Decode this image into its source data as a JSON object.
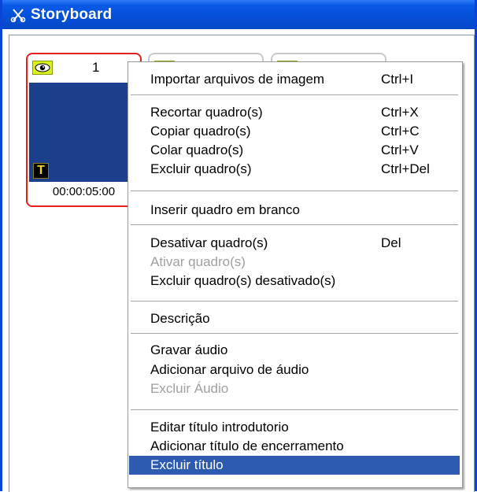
{
  "window": {
    "title": "Storyboard",
    "title_icon": "scissors-icon"
  },
  "frames": [
    {
      "number": "1",
      "duration": "00:00:05:00",
      "selected": true,
      "has_title": true,
      "title_badge": "T"
    },
    {
      "selected": false
    },
    {
      "selected": false
    }
  ],
  "context_menu": {
    "items": [
      {
        "label": "Importar arquivos de imagem",
        "shortcut": "Ctrl+I",
        "enabled": true
      },
      {
        "label": "Recortar quadro(s)",
        "shortcut": "Ctrl+X",
        "enabled": true
      },
      {
        "label": "Copiar quadro(s)",
        "shortcut": "Ctrl+C",
        "enabled": true
      },
      {
        "label": "Colar quadro(s)",
        "shortcut": "Ctrl+V",
        "enabled": true
      },
      {
        "label": "Excluir quadro(s)",
        "shortcut": "Ctrl+Del",
        "enabled": true
      },
      {
        "label": "Inserir quadro em branco",
        "shortcut": "",
        "enabled": true
      },
      {
        "label": "Desativar quadro(s)",
        "shortcut": "Del",
        "enabled": true
      },
      {
        "label": "Ativar quadro(s)",
        "shortcut": "",
        "enabled": false
      },
      {
        "label": "Excluir quadro(s) desativado(s)",
        "shortcut": "",
        "enabled": true
      },
      {
        "label": "Descrição",
        "shortcut": "",
        "enabled": true
      },
      {
        "label": "Gravar áudio",
        "shortcut": "",
        "enabled": true
      },
      {
        "label": "Adicionar arquivo de áudio",
        "shortcut": "",
        "enabled": true
      },
      {
        "label": "Excluir Áudio",
        "shortcut": "",
        "enabled": false
      },
      {
        "label": "Editar título introdutorio",
        "shortcut": "",
        "enabled": true
      },
      {
        "label": "Adicionar título de encerramento",
        "shortcut": "",
        "enabled": true
      },
      {
        "label": "Excluir título",
        "shortcut": "",
        "enabled": true,
        "highlighted": true
      }
    ]
  },
  "colors": {
    "titlebar": "#0550d8",
    "selected_frame_border": "#e81e1e",
    "thumbnail": "#1c3f8c",
    "menu_highlight": "#2d5bb1",
    "eye_badge": "#d9f01c"
  }
}
